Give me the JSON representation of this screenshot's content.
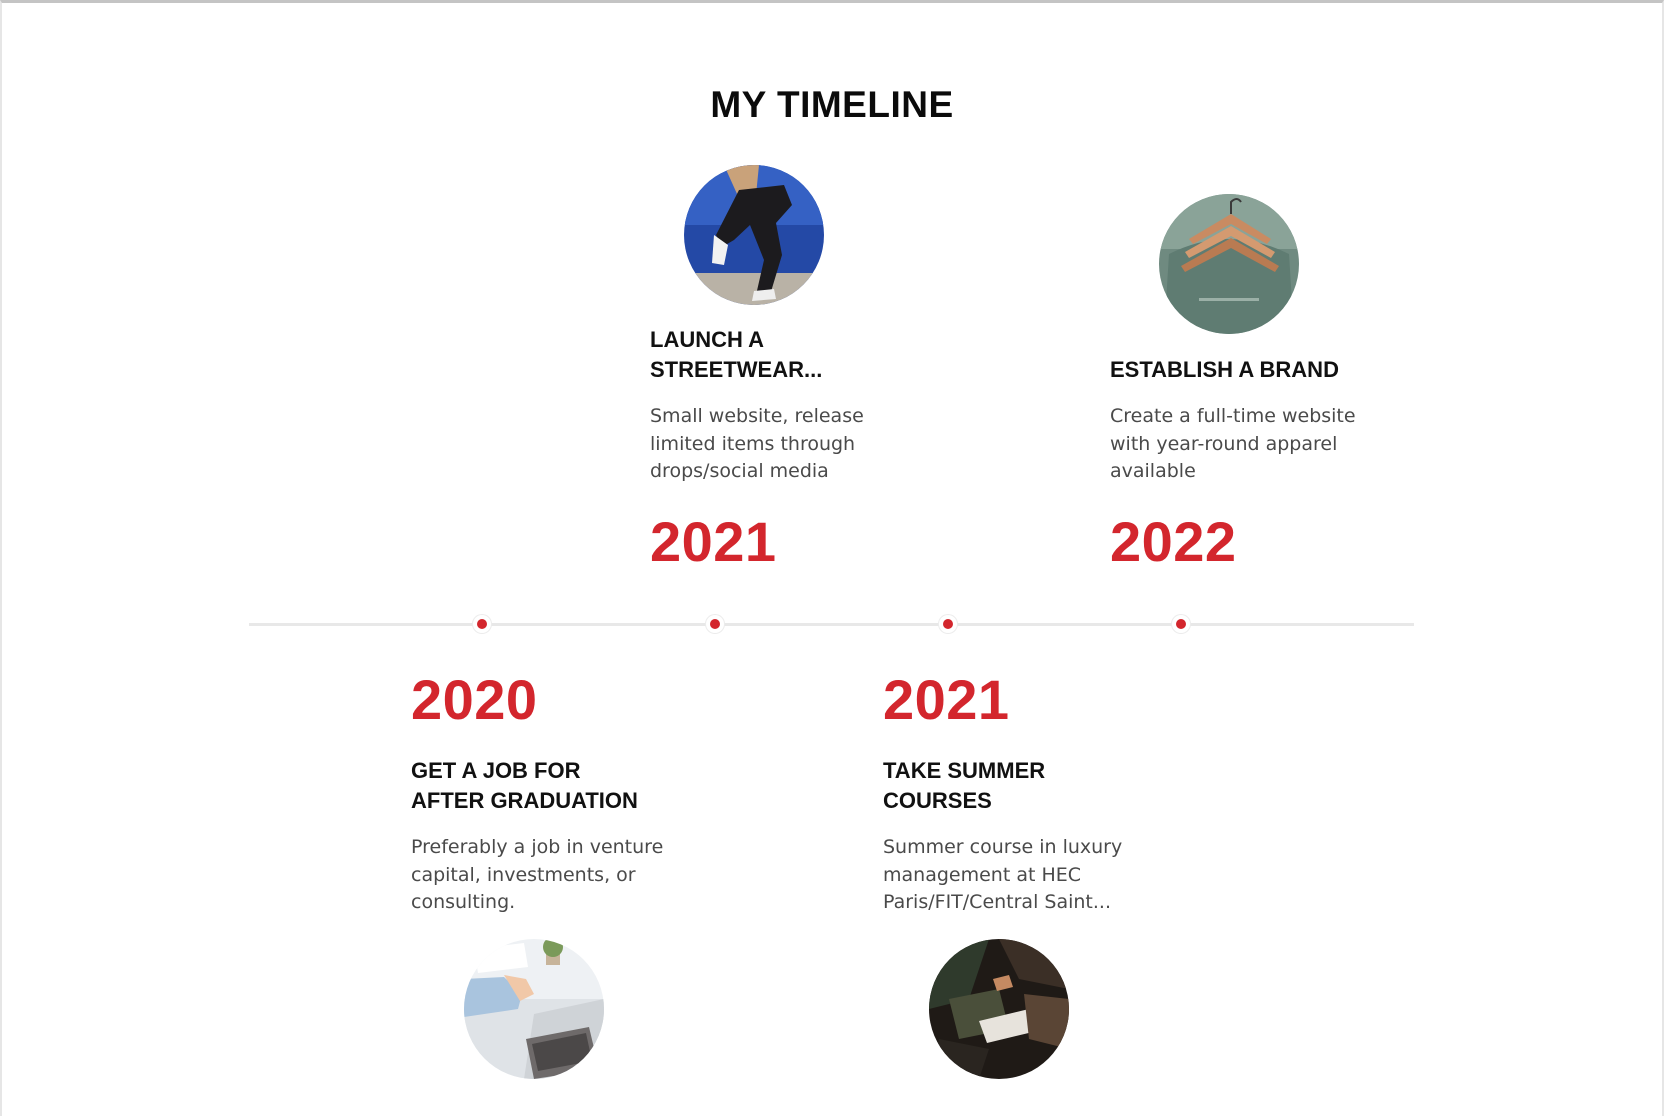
{
  "timeline": {
    "title": "MY TIMELINE",
    "accent_color": "#d3262d",
    "entries": [
      {
        "title_line1": "LAUNCH A",
        "title_line2": "STREETWEAR...",
        "desc_line1": "Small website, release",
        "desc_line2": "limited items through",
        "desc_line3": "drops/social media",
        "year": "2021",
        "image": "streetwear-sneakers-photo"
      },
      {
        "title_line1": "ESTABLISH A BRAND",
        "desc_line1": "Create a full-time website",
        "desc_line2": "with year-round apparel",
        "desc_line3": "available",
        "year": "2022",
        "image": "clothes-hangers-photo"
      },
      {
        "year": "2020",
        "title_line1": "GET A JOB FOR",
        "title_line2": "AFTER GRADUATION",
        "desc_line1": "Preferably a job in venture",
        "desc_line2": "capital, investments, or",
        "desc_line3": "consulting.",
        "image": "laptop-desk-photo"
      },
      {
        "year": "2021",
        "title_line1": "TAKE SUMMER",
        "title_line2": "COURSES",
        "desc_line1": "Summer course in luxury",
        "desc_line2": "management at HEC",
        "desc_line3": "Paris/FIT/Central Saint...",
        "image": "classroom-notes-photo"
      }
    ]
  }
}
